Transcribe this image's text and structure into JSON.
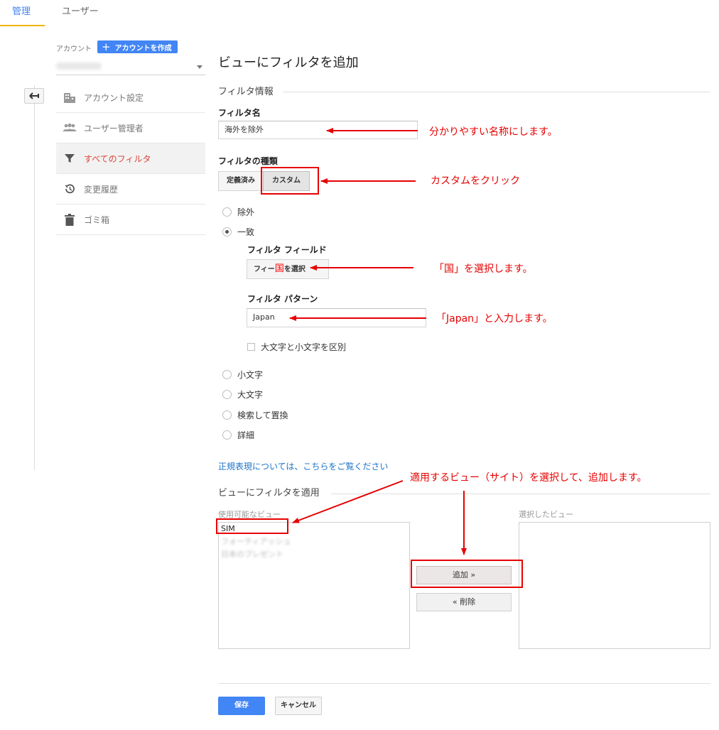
{
  "tabs": {
    "admin": "管理",
    "users": "ユーザー"
  },
  "account": {
    "label": "アカウント",
    "create_button": "アカウントを作成"
  },
  "nav": {
    "items": [
      {
        "label": "アカウント設定",
        "icon": "building-icon"
      },
      {
        "label": "ユーザー管理者",
        "icon": "people-icon"
      },
      {
        "label": "すべてのフィルタ",
        "icon": "filter-icon",
        "active": true
      },
      {
        "label": "変更履歴",
        "icon": "history-icon"
      },
      {
        "label": "ゴミ箱",
        "icon": "trash-icon"
      }
    ]
  },
  "page": {
    "title": "ビューにフィルタを追加"
  },
  "filter_info": {
    "heading": "フィルタ情報",
    "name_label": "フィルタ名",
    "name_value": "海外を除外",
    "type_label": "フィルタの種類",
    "type_options": [
      "定義済み",
      "カスタム"
    ],
    "selected_type": "カスタム"
  },
  "filter_mode": {
    "exclude": "除外",
    "include": "一致",
    "selected": "一致",
    "field_label": "フィルタ フィールド",
    "field_button_left": "フィー",
    "field_button_overlay": "国",
    "field_button_right": "を選択",
    "pattern_label": "フィルタ パターン",
    "pattern_value": "Japan",
    "case_sensitive": "大文字と小文字を区別",
    "lowercase": "小文字",
    "uppercase": "大文字",
    "search_replace": "検索して置換",
    "advanced": "詳細"
  },
  "regex_link": "正規表現については、こちらをご覧ください",
  "apply": {
    "heading": "ビューにフィルタを適用",
    "available_label": "使用可能なビュー",
    "selected_label": "選択したビュー",
    "available_views": [
      "SIM",
      "フォーティアッシュ",
      "日本のプレゼント"
    ],
    "add_button": "追加 »",
    "remove_button": "« 削除"
  },
  "footer": {
    "save": "保存",
    "cancel": "キャンセル"
  },
  "annotations": {
    "name_note": "分かりやすい名称にします。",
    "custom_note": "カスタムをクリック",
    "country_note": "「国」を選択します。",
    "japan_note": "「Japan」と入力します。",
    "apply_note": "適用するビュー（サイト）を選択して、追加します。"
  },
  "colors": {
    "accent": "#4285f4",
    "active_nav": "#db4437",
    "annotation": "#e60000",
    "tab_underline": "#f4b400"
  }
}
